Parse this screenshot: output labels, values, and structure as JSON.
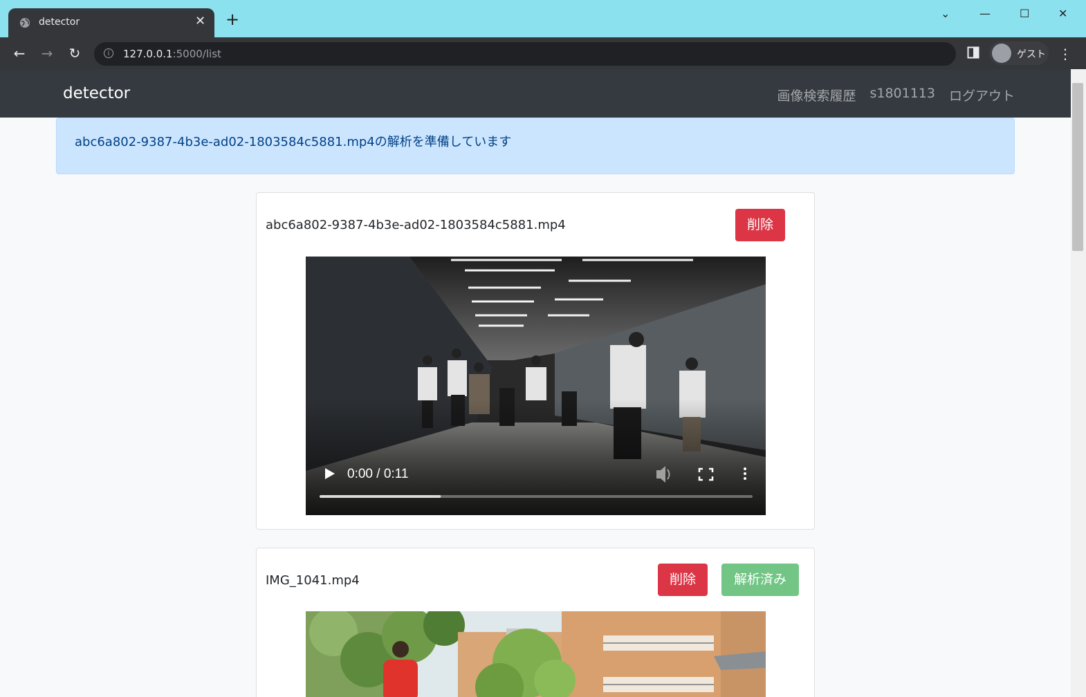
{
  "browser": {
    "tab_title": "detector",
    "url_host": "127.0.0.1",
    "url_path": ":5000/list",
    "profile_label": "ゲスト"
  },
  "app": {
    "brand": "detector",
    "nav": [
      "画像検索履歴",
      "s1801113",
      "ログアウト"
    ]
  },
  "alert": {
    "message": "abc6a802-9387-4b3e-ad02-1803584c5881.mp4の解析を準備しています"
  },
  "videos": [
    {
      "filename": "abc6a802-9387-4b3e-ad02-1803584c5881.mp4",
      "delete_label": "削除",
      "time": "0:00 / 0:11",
      "progress_buffered": 0.28
    },
    {
      "filename": "IMG_1041.mp4",
      "delete_label": "削除",
      "status_label": "解析済み"
    }
  ]
}
